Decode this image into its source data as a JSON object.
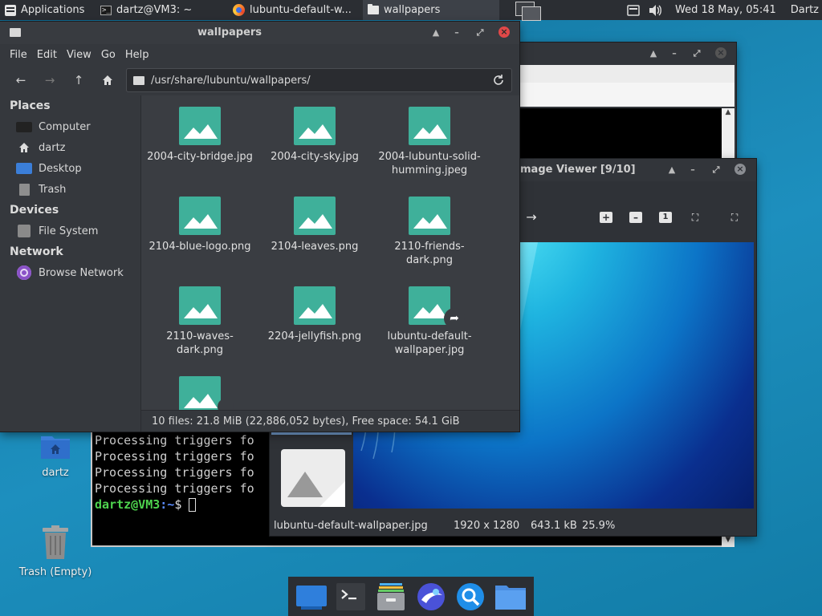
{
  "top_panel": {
    "applications_label": "Applications",
    "tasks": [
      {
        "label": "dartz@VM3: ~",
        "icon": "terminal-icon"
      },
      {
        "label": "lubuntu-default-w...",
        "icon": "firefox-icon"
      },
      {
        "label": "wallpapers",
        "icon": "folder-icon",
        "active": true
      }
    ],
    "clock": "Wed 18 May, 05:41",
    "user": "Dartz"
  },
  "file_manager": {
    "title": "wallpapers",
    "menu": [
      "File",
      "Edit",
      "View",
      "Go",
      "Help"
    ],
    "path": "/usr/share/lubuntu/wallpapers/",
    "sidebar": {
      "places_header": "Places",
      "places": [
        "Computer",
        "dartz",
        "Desktop",
        "Trash"
      ],
      "devices_header": "Devices",
      "devices": [
        "File System"
      ],
      "network_header": "Network",
      "network": [
        "Browse Network"
      ]
    },
    "files": [
      {
        "line1": "2004-city-bridge.jpg",
        "line2": ""
      },
      {
        "line1": "2004-city-sky.jpg",
        "line2": ""
      },
      {
        "line1": "2004-lubuntu-solid-",
        "line2": "humming.jpeg"
      },
      {
        "line1": "2104-blue-logo.png",
        "line2": ""
      },
      {
        "line1": "2104-leaves.png",
        "line2": ""
      },
      {
        "line1": "2110-friends-",
        "line2": "dark.png"
      },
      {
        "line1": "2110-waves-",
        "line2": "dark.png"
      },
      {
        "line1": "2204-jellyfish.png",
        "line2": ""
      },
      {
        "line1": "lubuntu-default-",
        "line2": "wallpaper.jpg"
      }
    ],
    "status": "10 files: 21.8 MiB (22,886,052 bytes), Free space: 54.1 GiB"
  },
  "image_viewer": {
    "title": "mage Viewer [9/10]",
    "filename": "lubuntu-default-wallpaper.jpg",
    "dimensions": "1920 x 1280",
    "size": "643.1 kB",
    "zoom": "25.9%"
  },
  "terminal": {
    "lines": [
      "Processing triggers fo",
      "Processing triggers fo",
      "Processing triggers fo",
      "Processing triggers fo"
    ],
    "prompt_user": "dartz@VM3",
    "prompt_path": ":~",
    "prompt_symbol": "$ "
  },
  "desktop": {
    "home_icon_label": "dartz",
    "trash_icon_label": "Trash (Empty)"
  },
  "colors": {
    "accent": "#3fb09a",
    "close": "#e04848",
    "prompt_green": "#4ed34e",
    "prompt_blue": "#5a8cff"
  }
}
